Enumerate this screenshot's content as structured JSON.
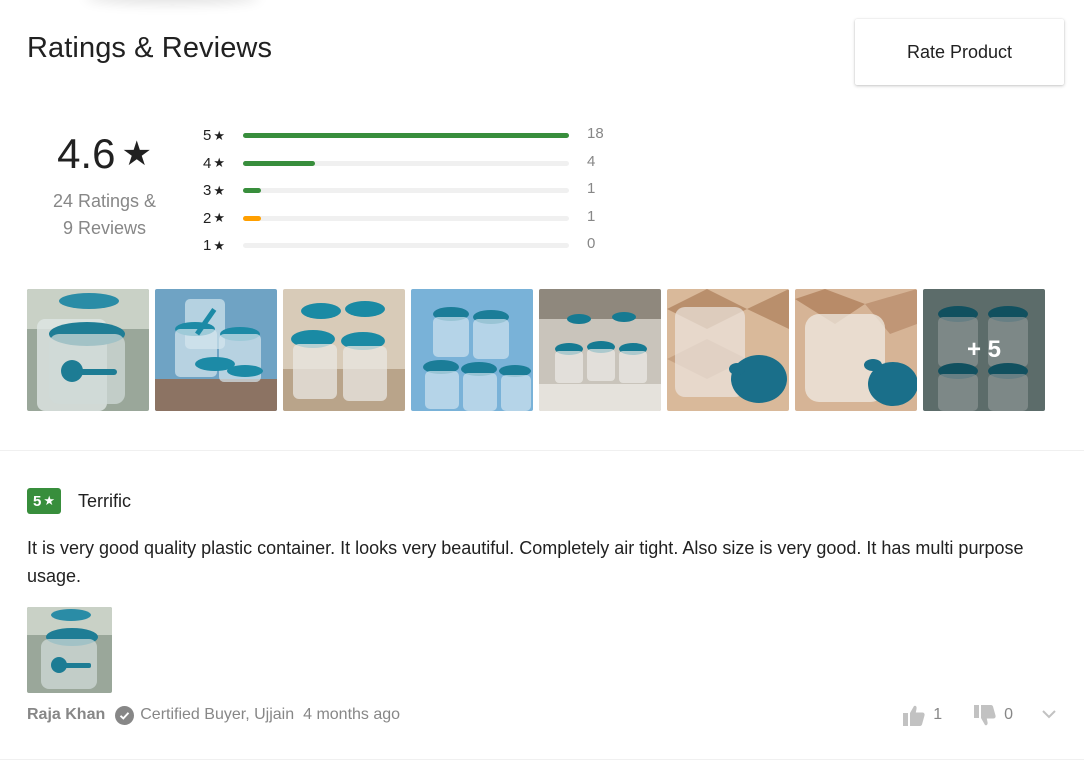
{
  "header": {
    "title": "Ratings & Reviews",
    "rate_button": "Rate Product"
  },
  "summary": {
    "average": "4.6",
    "star_glyph": "★",
    "ratings_text": "24 Ratings &",
    "reviews_text": "9 Reviews",
    "breakdown": [
      {
        "stars": "5",
        "count": "18",
        "fraction": 1.0,
        "color": "#388e3c"
      },
      {
        "stars": "4",
        "count": "4",
        "fraction": 0.22,
        "color": "#388e3c"
      },
      {
        "stars": "3",
        "count": "1",
        "fraction": 0.055,
        "color": "#388e3c"
      },
      {
        "stars": "2",
        "count": "1",
        "fraction": 0.055,
        "color": "#ff9f00"
      },
      {
        "stars": "1",
        "count": "0",
        "fraction": 0,
        "color": "#388e3c"
      }
    ]
  },
  "gallery": {
    "more_label": "+ 5"
  },
  "review": {
    "rating": "5",
    "title": "Terrific",
    "text": "It is very good quality plastic container. It looks very beautiful. Completely air tight. Also size is very good. It has multi purpose usage.",
    "author": "Raja Khan",
    "certified": "Certified Buyer, Ujjain",
    "when": "4 months ago",
    "likes": "1",
    "dislikes": "0"
  },
  "colors": {
    "accent_green": "#388e3c",
    "accent_orange": "#ff9f00",
    "muted_text": "#878787"
  }
}
